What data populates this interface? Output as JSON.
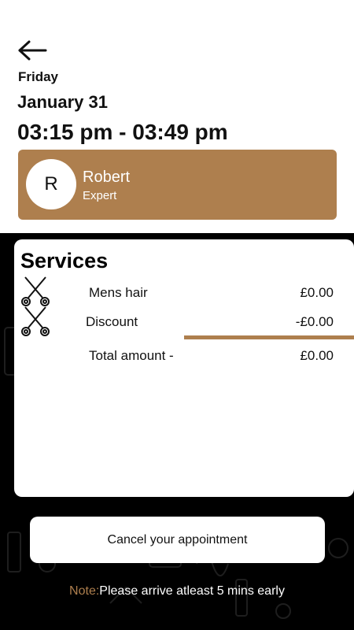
{
  "header": {
    "back_icon": "arrow-left-icon",
    "day": "Friday",
    "date": "January 31",
    "time_range": "03:15 pm - 03:49 pm"
  },
  "stylist": {
    "initial": "R",
    "name": "Robert",
    "role": "Expert",
    "color": "#ae7f4e"
  },
  "services": {
    "title": "Services",
    "icon": "scissors-icon",
    "items": [
      {
        "label": "Mens hair",
        "value": "£0.00"
      },
      {
        "label": "Discount",
        "value": "-£0.00"
      }
    ],
    "total_label": "Total amount -",
    "total_value": "£0.00"
  },
  "actions": {
    "cancel_label": "Cancel your appointment"
  },
  "note": {
    "label": "Note:",
    "text": "Please arrive atleast 5 mins early"
  }
}
